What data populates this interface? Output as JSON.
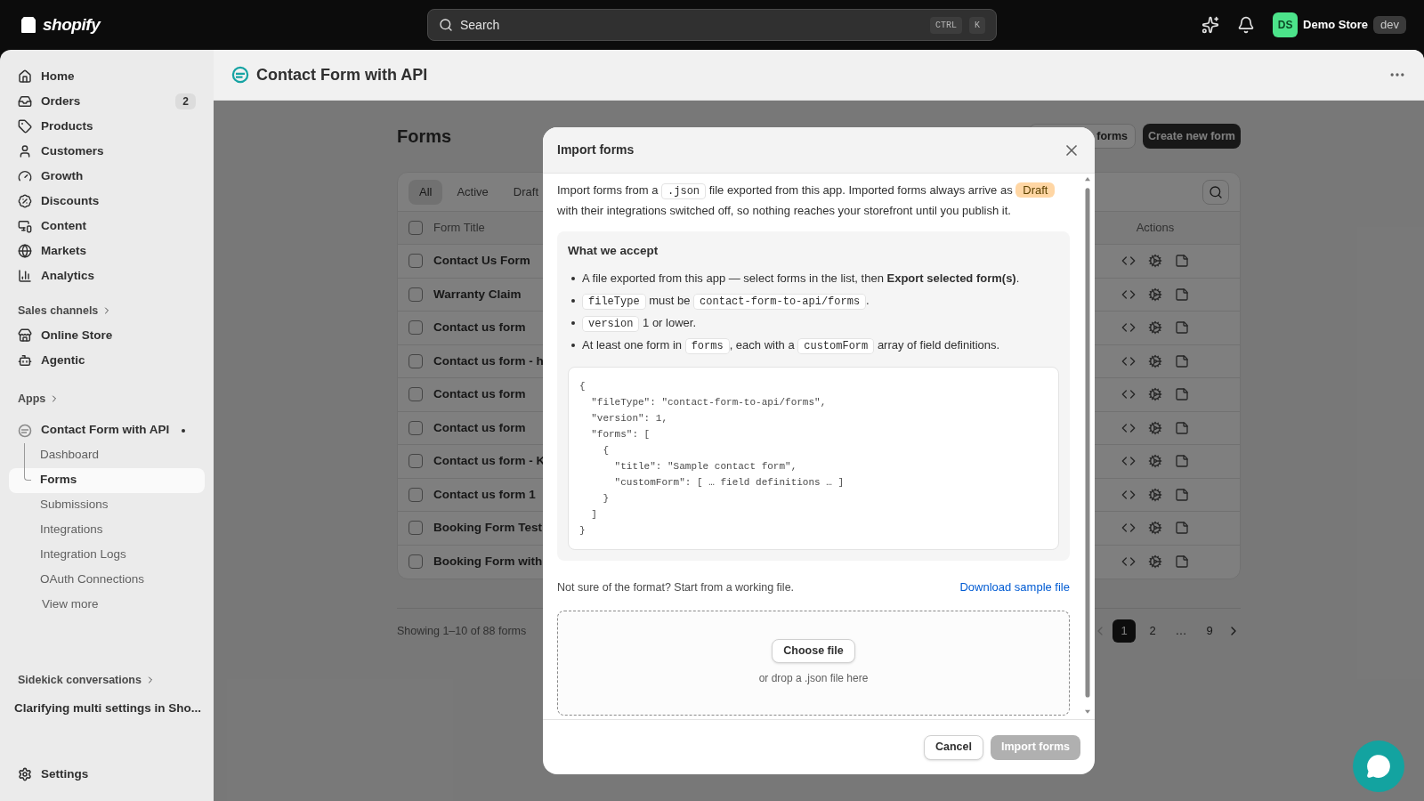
{
  "topbar": {
    "logo_text": "shopify",
    "search": {
      "placeholder": "Search",
      "shortcut": [
        "CTRL",
        "K"
      ]
    },
    "store": {
      "initials": "DS",
      "name": "Demo Store",
      "badge": "dev"
    }
  },
  "sidebar": {
    "nav": [
      {
        "label": "Home"
      },
      {
        "label": "Orders",
        "badge": "2"
      },
      {
        "label": "Products"
      },
      {
        "label": "Customers"
      },
      {
        "label": "Growth"
      },
      {
        "label": "Discounts"
      },
      {
        "label": "Content"
      },
      {
        "label": "Markets"
      },
      {
        "label": "Analytics"
      }
    ],
    "sales_channels": {
      "heading": "Sales channels",
      "items": [
        {
          "label": "Online Store"
        },
        {
          "label": "Agentic"
        }
      ]
    },
    "apps": {
      "heading": "Apps",
      "app": {
        "label": "Contact Form with API",
        "children": [
          {
            "label": "Dashboard",
            "selected": false
          },
          {
            "label": "Forms",
            "selected": true
          },
          {
            "label": "Submissions",
            "selected": false
          },
          {
            "label": "Integrations",
            "selected": false
          },
          {
            "label": "Integration Logs",
            "selected": false
          },
          {
            "label": "OAuth Connections",
            "selected": false
          }
        ],
        "more": "View more"
      }
    },
    "sidekick": {
      "heading": "Sidekick conversations",
      "item": "Clarifying multi settings in Sho..."
    },
    "settings": "Settings"
  },
  "header": {
    "title": "Contact Form with API"
  },
  "page": {
    "title": "Forms",
    "buttons": [
      {
        "label": "forms",
        "kind": "secondary"
      },
      {
        "label": "Create new form",
        "kind": "primary"
      }
    ],
    "tabs": [
      {
        "label": "All",
        "selected": true
      },
      {
        "label": "Active",
        "selected": false
      },
      {
        "label": "Draft",
        "selected": false
      }
    ],
    "columns": [
      "Form Title",
      "Actions"
    ],
    "select_all_checked": false,
    "rows": [
      {
        "title": "Contact Us Form",
        "checked": false
      },
      {
        "title": "Warranty Claim",
        "checked": false
      },
      {
        "title": "Contact us form",
        "checked": false
      },
      {
        "title": "Contact us form - h",
        "checked": false
      },
      {
        "title": "Contact us form",
        "checked": false
      },
      {
        "title": "Contact us form",
        "checked": false
      },
      {
        "title": "Contact us form - K",
        "checked": false
      },
      {
        "title": "Contact us form 1",
        "checked": false
      },
      {
        "title": "Booking Form Test",
        "checked": false
      },
      {
        "title": "Booking Form with",
        "checked": false
      }
    ],
    "footer": "Showing 1–10 of 88 forms",
    "pagination": [
      {
        "label": "1",
        "selected": true
      },
      {
        "label": "2",
        "selected": false
      },
      {
        "label": "…",
        "selected": false
      },
      {
        "label": "9",
        "selected": false
      }
    ]
  },
  "modal": {
    "title": "Import forms",
    "intro": [
      {
        "kind": "text",
        "text": "Import forms from a "
      },
      {
        "kind": "code",
        "text": ".json"
      },
      {
        "kind": "text",
        "text": " file exported from this app. Imported forms always arrive as "
      },
      {
        "kind": "badge",
        "text": "Draft"
      },
      {
        "kind": "text",
        "text": " with their integrations switched off, so nothing reaches your storefront until you publish it."
      }
    ],
    "accept": {
      "heading": "What we accept",
      "bullets": [
        [
          {
            "kind": "text",
            "text": "A file exported from this app — select forms in the list, then "
          },
          {
            "kind": "bold",
            "text": "Export selected form(s)"
          },
          {
            "kind": "text",
            "text": "."
          }
        ],
        [
          {
            "kind": "code",
            "text": "fileType"
          },
          {
            "kind": "text",
            "text": " must be "
          },
          {
            "kind": "code",
            "text": "contact-form-to-api/forms"
          },
          {
            "kind": "text",
            "text": "."
          }
        ],
        [
          {
            "kind": "code",
            "text": "version"
          },
          {
            "kind": "text",
            "text": " 1 or lower."
          }
        ],
        [
          {
            "kind": "text",
            "text": "At least one form in "
          },
          {
            "kind": "code",
            "text": "forms"
          },
          {
            "kind": "text",
            "text": ", each with a "
          },
          {
            "kind": "code",
            "text": "customForm"
          },
          {
            "kind": "text",
            "text": " array of field definitions."
          }
        ]
      ],
      "example": "{\n  \"fileType\": \"contact-form-to-api/forms\",\n  \"version\": 1,\n  \"forms\": [\n    {\n      \"title\": \"Sample contact form\",\n      \"customForm\": [ … field definitions … ]\n    }\n  ]\n}"
    },
    "hint": "Not sure of the format? Start from a working file.",
    "download": "Download sample file",
    "dropzone": {
      "button": "Choose file",
      "hint": "or drop a .json file here"
    },
    "cancel": "Cancel",
    "submit": {
      "label": "Import forms",
      "disabled": true
    }
  }
}
